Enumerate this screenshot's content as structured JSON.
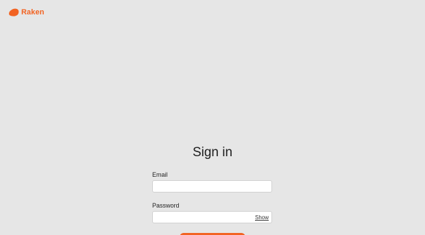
{
  "brand": {
    "name": "Raken",
    "accent_color": "#f26322",
    "logo_icon": "raken-logo-icon"
  },
  "signin": {
    "title": "Sign in",
    "email_label": "Email",
    "email_value": "",
    "password_label": "Password",
    "password_value": "",
    "show_label": "Show"
  }
}
